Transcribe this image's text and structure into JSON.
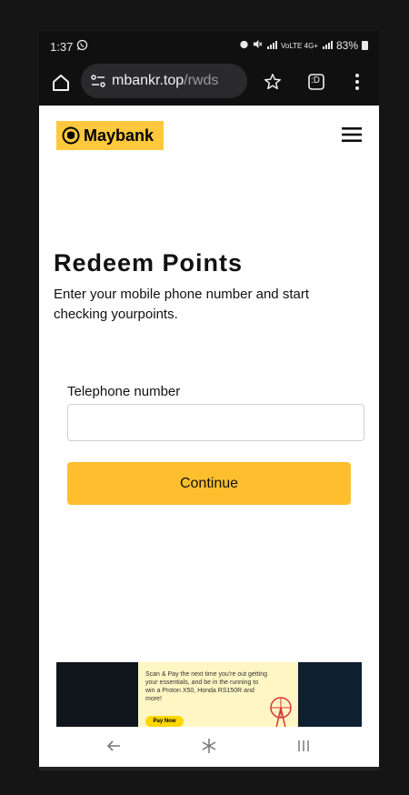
{
  "status_bar": {
    "time": "1:37",
    "network_small": "VoLTE 4G+",
    "battery": "83%"
  },
  "browser": {
    "url_host": "mbankr.top",
    "url_path": "/rwds",
    "tab_label": ":D"
  },
  "site": {
    "logo_text": "Maybank",
    "title": "Redeem Points",
    "subtitle": "Enter your mobile phone number and start checking yourpoints.",
    "field_label": "Telephone number",
    "field_value": "",
    "continue_label": "Continue"
  },
  "banner": {
    "text": "Scan & Pay the next time you're out getting your essentials, and be in the running to win a Proton X50, Honda RS150R and more!",
    "button_label": "Pay Now"
  },
  "colors": {
    "brand_yellow": "#ffc83d",
    "button_yellow": "#fdbf2d",
    "chrome_dark": "#101010"
  }
}
